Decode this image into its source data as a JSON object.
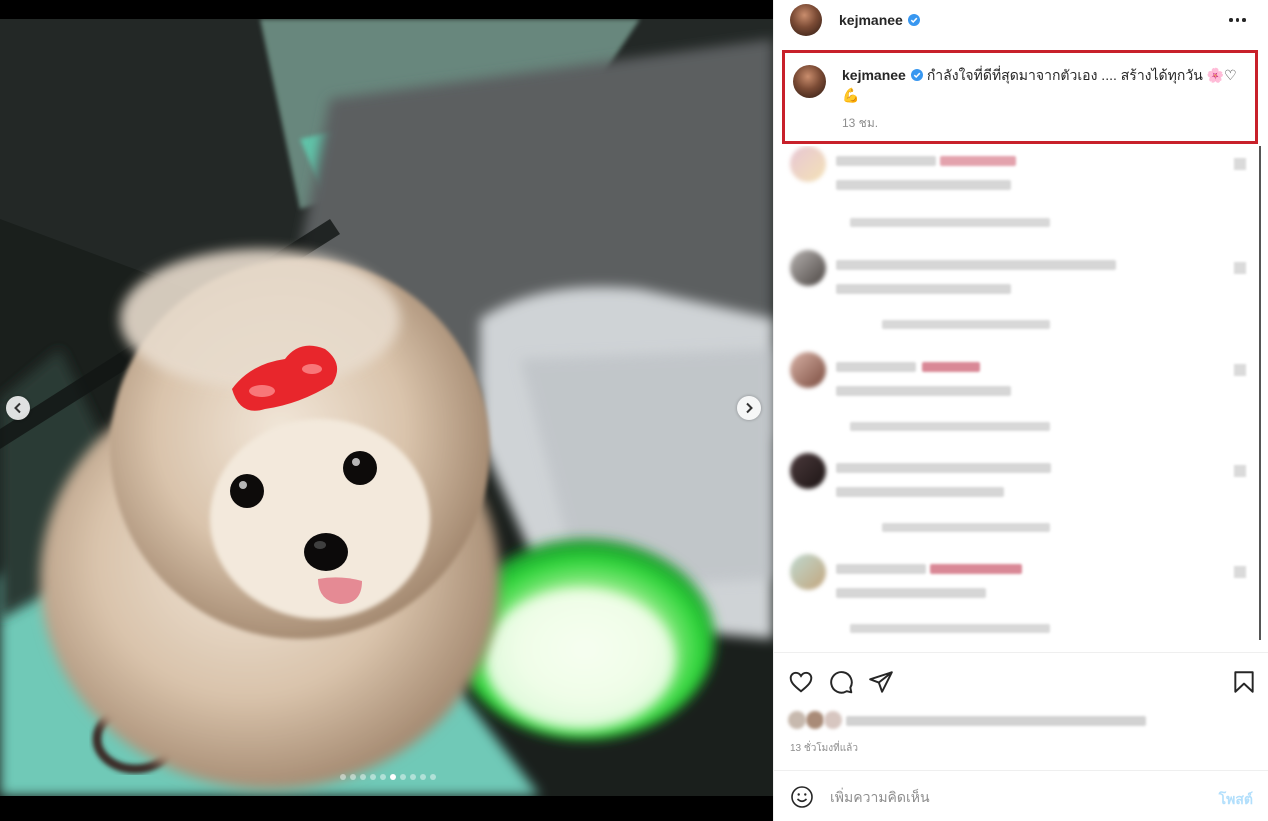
{
  "post": {
    "username": "kejmanee",
    "verified": true,
    "caption": "กำลังใจที่ดีที่สุดมาจากตัวเอง .... สร้างได้ทุกวัน 🌸♡💪",
    "caption_time": "13 ชม.",
    "post_time": "13 ชั่วโมงที่แล้ว"
  },
  "carousel": {
    "total_slides": 10,
    "active_slide": 6
  },
  "comment_bar": {
    "placeholder": "เพิ่มความคิดเห็น",
    "post_label": "โพสต์"
  },
  "icons": {
    "verified": "verified-badge-icon",
    "more": "more-options-icon",
    "prev": "chevron-left-icon",
    "next": "chevron-right-icon",
    "like": "heart-icon",
    "comment": "comment-bubble-icon",
    "share": "paper-plane-icon",
    "save": "bookmark-icon",
    "emoji": "smiley-icon"
  },
  "colors": {
    "verified_blue": "#3897f0",
    "highlight_border": "#c8202a",
    "post_button": "#b2dffc",
    "hair_clip": "#e8262c"
  }
}
